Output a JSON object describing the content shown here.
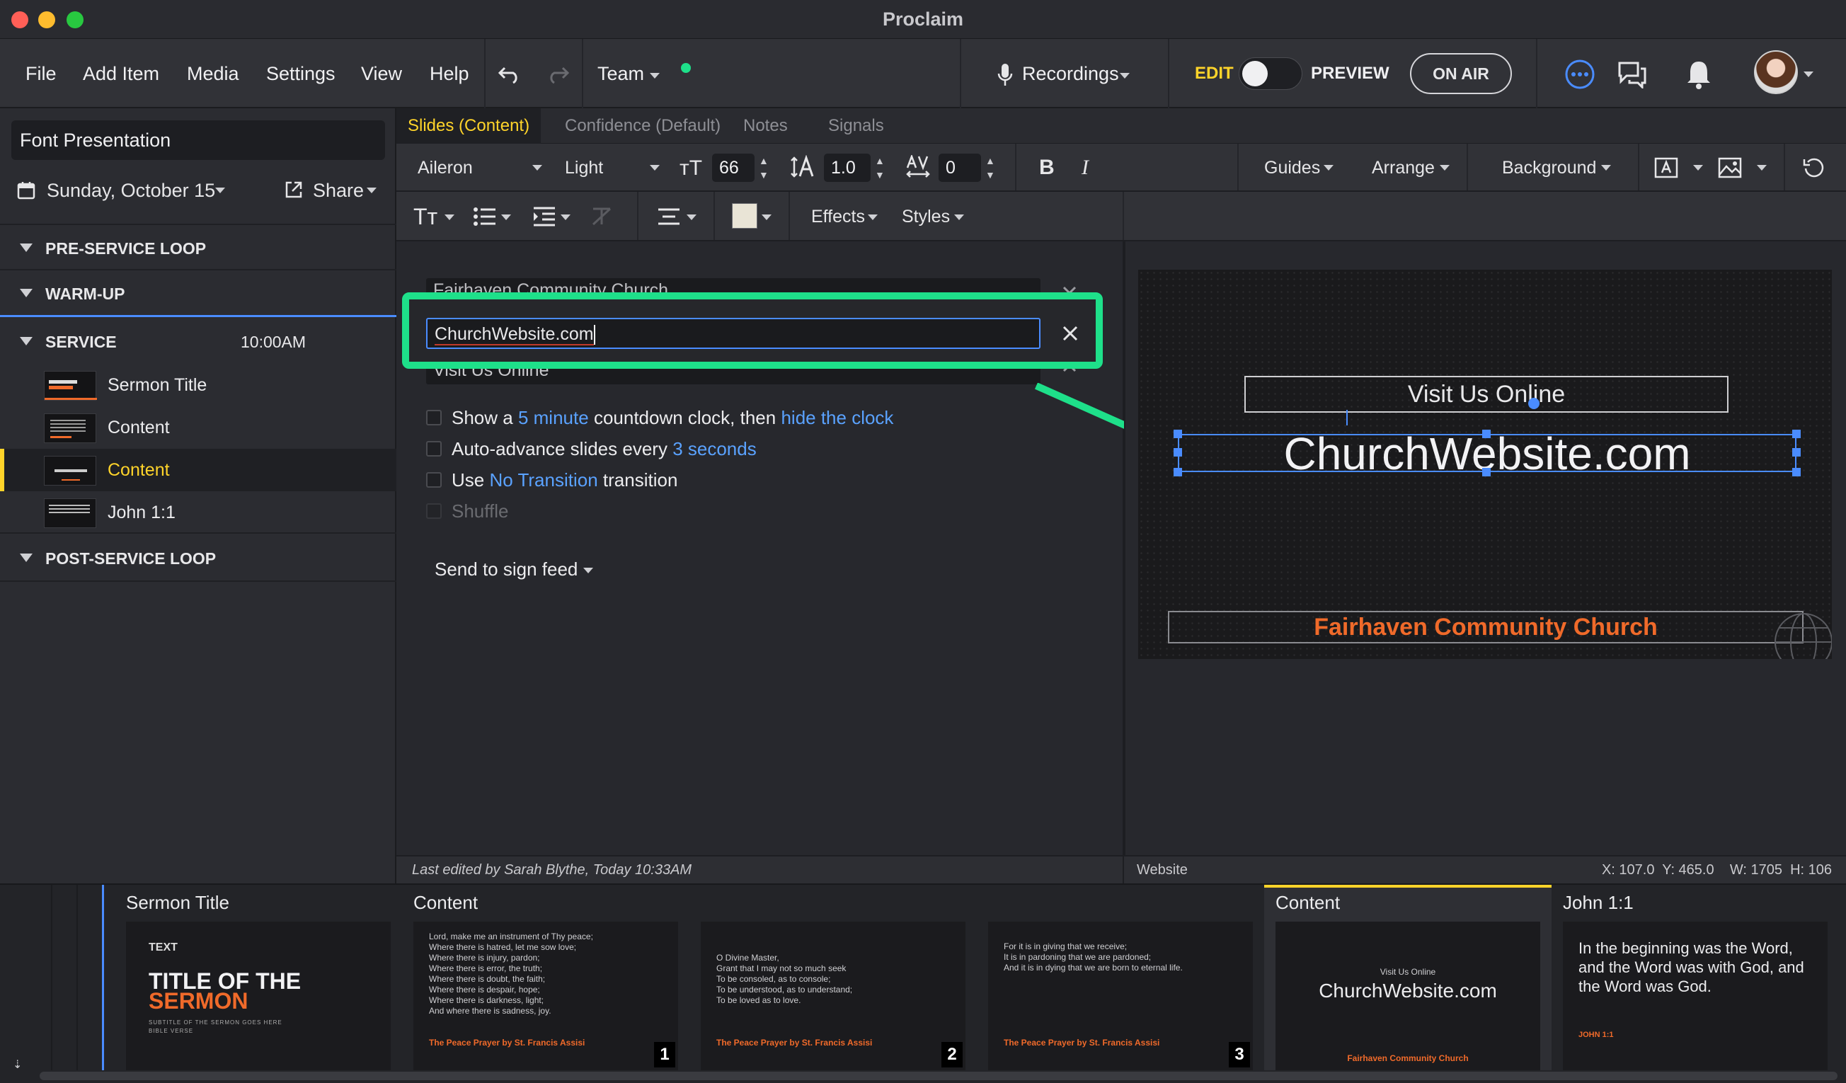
{
  "window": {
    "title": "Proclaim"
  },
  "menubar": {
    "items": [
      "File",
      "Add Item",
      "Media",
      "Settings",
      "View",
      "Help"
    ],
    "team_label": "Team",
    "recordings_label": "Recordings",
    "edit_label": "EDIT",
    "preview_label": "PREVIEW",
    "on_air_label": "ON AIR",
    "colors": {
      "accent_yellow": "#ffd42a",
      "team_status": "#1ee08a",
      "chat_blue": "#4a8cff"
    }
  },
  "sidebar": {
    "presentation_name": "Font Presentation",
    "date_label": "Sunday, October 15",
    "share_label": "Share",
    "sections": {
      "pre_service": "PRE-SERVICE LOOP",
      "warm_up": "WARM-UP",
      "service": "SERVICE",
      "service_time": "10:00AM",
      "post_service": "POST-SERVICE LOOP"
    },
    "items": [
      {
        "label": "Sermon Title"
      },
      {
        "label": "Content"
      },
      {
        "label": "Content",
        "selected": true
      },
      {
        "label": "John 1:1"
      }
    ]
  },
  "tabs": [
    "Slides (Content)",
    "Confidence (Default)",
    "Notes",
    "Signals"
  ],
  "toolbar": {
    "font": "Aileron",
    "weight": "Light",
    "size": "66",
    "line_height": "1.0",
    "tracking": "0",
    "bold": "B",
    "italic": "I",
    "guides": "Guides",
    "arrange": "Arrange",
    "background": "Background",
    "effects": "Effects",
    "styles": "Styles",
    "swatch_color": "#e9e4d6"
  },
  "editor": {
    "field1": "Fairhaven Community Church",
    "field2": "ChurchWebsite.com",
    "field3": "Visit Us Online",
    "options": {
      "show_a": "Show a",
      "countdown_value": "5 minute",
      "countdown_text": "countdown clock, then",
      "hide_clock": "hide the clock",
      "auto_advance": "Auto-advance slides every",
      "seconds": "3 seconds",
      "use": "Use",
      "transition_value": "No Transition",
      "transition": "transition",
      "shuffle": "Shuffle"
    },
    "send_to_sign_feed": "Send to sign feed",
    "highlight_color": "#1ee08a"
  },
  "preview": {
    "line1": "Visit Us Online",
    "line2": "ChurchWebsite.com",
    "line3": "Fairhaven Community Church",
    "line3_color": "#f06a2a"
  },
  "status": {
    "last_edited": "Last edited by Sarah Blythe, Today 10:33AM",
    "element_name": "Website",
    "coords": "X: 107.0  Y: 465.0    W: 1705  H: 106"
  },
  "strip": {
    "slides": [
      {
        "label": "Sermon Title",
        "small_text": "TEXT",
        "title1": "TITLE OF THE",
        "title2": "SERMON",
        "subtitle": "SUBTITLE OF THE SERMON GOES HERE",
        "verse": "BIBLE VERSE"
      },
      {
        "label": "Content",
        "lines": [
          "Lord, make me an instrument of Thy peace;",
          "Where there is hatred, let me sow love;",
          "Where there is injury, pardon;",
          "Where there is error, the truth;",
          "Where there is doubt, the faith;",
          "Where there is despair, hope;",
          "Where there is darkness, light;",
          "And where there is sadness, joy."
        ],
        "caption": "The Peace Prayer by St. Francis Assisi",
        "num": "1"
      },
      {
        "label": "",
        "lines": [
          "O Divine Master,",
          "Grant that I may not so much seek",
          "To be consoled, as to console;",
          "To be understood, as to understand;",
          "To be loved as to love."
        ],
        "caption": "The Peace Prayer by St. Francis Assisi",
        "num": "2"
      },
      {
        "label": "",
        "lines": [
          "For it is in giving that we receive;",
          "It is in pardoning that we are pardoned;",
          "And it is in dying that we are born to eternal life."
        ],
        "caption": "The Peace Prayer by St. Francis Assisi",
        "num": "3"
      },
      {
        "label": "Content",
        "small": "Visit Us Online",
        "big": "ChurchWebsite.com",
        "footer": "Fairhaven Community Church"
      },
      {
        "label": "John 1:1",
        "verse_text": "In the beginning was the Word, and the Word was with God, and the Word was God.",
        "ref": "JOHN 1:1"
      }
    ]
  }
}
